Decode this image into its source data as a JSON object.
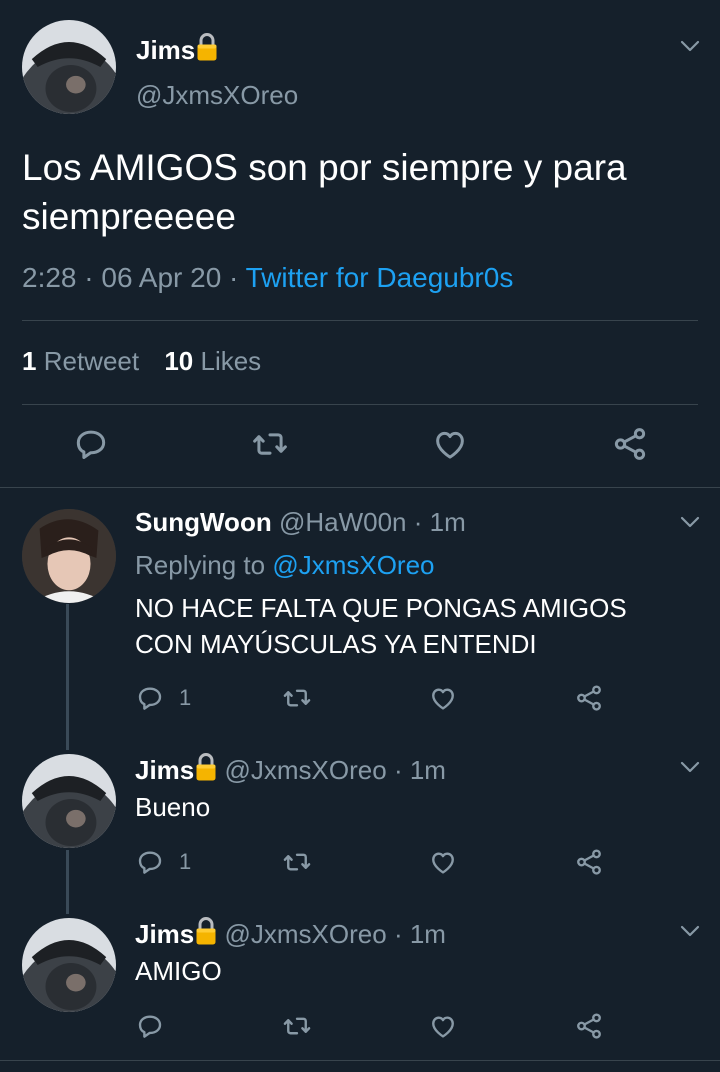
{
  "colors": {
    "background": "#15202b",
    "text": "#ffffff",
    "muted": "#8899a6",
    "link": "#1da1f2",
    "divider": "#38444d",
    "lock": "#f5b400"
  },
  "main_tweet": {
    "display_name": "Jims",
    "lock_icon": "lock-icon",
    "handle": "@JxmsXOreo",
    "text": "Los AMIGOS son por siempre y para siempreeeee",
    "time": "2:28",
    "date": "06 Apr 20",
    "source": "Twitter for Daegubr0s",
    "retweet_count": "1",
    "retweet_label": "Retweet",
    "like_count": "10",
    "like_label": "Likes",
    "actions": [
      "reply-icon",
      "retweet-icon",
      "like-icon",
      "share-icon"
    ]
  },
  "replies": [
    {
      "display_name": "SungWoon",
      "handle": "@HaW00n",
      "time": "1m",
      "replying_prefix": "Replying to",
      "replying_to": "@JxmsXOreo",
      "text_line1": "NO HACE FALTA QUE PONGAS AMIGOS",
      "text_line2": "CON MAYÚSCULAS YA ENTENDI",
      "reply_count": "1"
    },
    {
      "display_name": "Jims",
      "handle": "@JxmsXOreo",
      "time": "1m",
      "text": "Bueno",
      "reply_count": "1"
    },
    {
      "display_name": "Jims",
      "handle": "@JxmsXOreo",
      "time": "1m",
      "text": "AMIGO",
      "reply_count": ""
    }
  ],
  "separator": "·"
}
